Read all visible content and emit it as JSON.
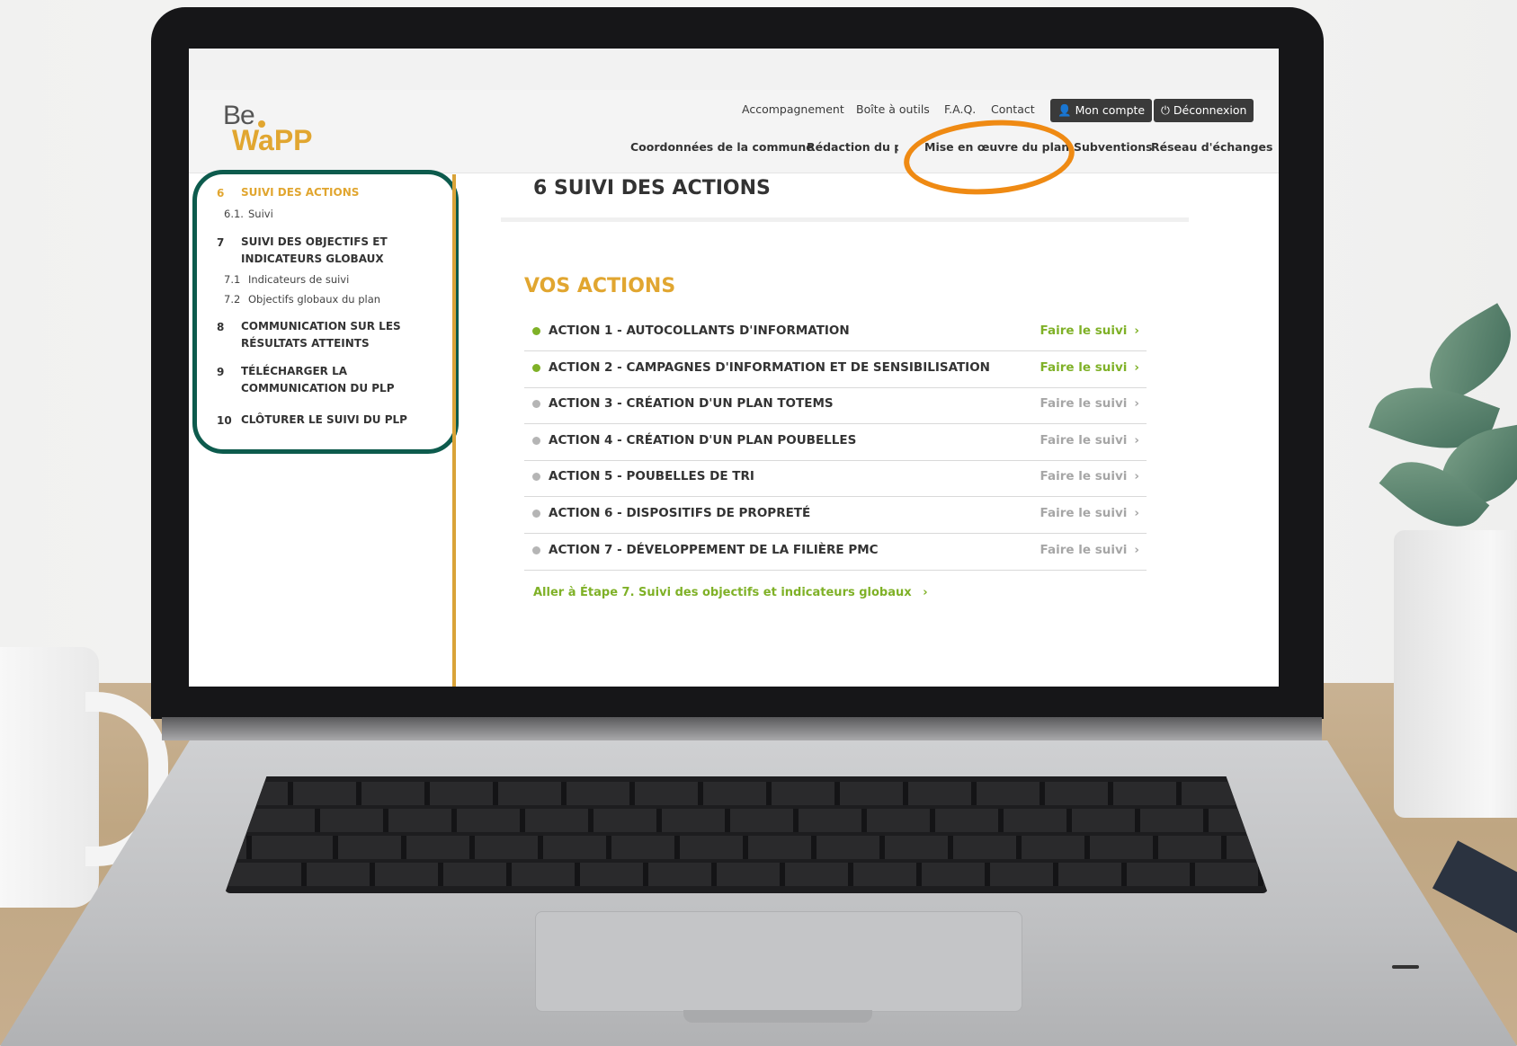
{
  "header": {
    "logo_line1": "Be",
    "logo_line2": "WaPP",
    "utility_links": [
      "Accompagnement",
      "Boîte à outils",
      "F.A.Q.",
      "Contact"
    ],
    "account_button": "Mon compte",
    "logout_button": "Déconnexion",
    "main_nav": [
      "Coordonnées de la commune",
      "Rédaction du plan",
      "Mise en œuvre du plan",
      "Subventions",
      "Réseau d'échanges"
    ],
    "highlighted_nav": "Mise en œuvre du plan"
  },
  "sidebar": {
    "items": [
      {
        "num": "6",
        "title": "SUIVI DES ACTIONS",
        "active": true,
        "subs": [
          {
            "num": "6.1.",
            "label": "Suivi"
          }
        ]
      },
      {
        "num": "7",
        "title_lines": [
          "SUIVI DES OBJECTIFS ET",
          "INDICATEURS GLOBAUX"
        ],
        "subs": [
          {
            "num": "7.1",
            "label": "Indicateurs de suivi"
          },
          {
            "num": "7.2",
            "label": "Objectifs globaux du plan"
          }
        ]
      },
      {
        "num": "8",
        "title_lines": [
          "COMMUNICATION SUR LES",
          "RÉSULTATS ATTEINTS"
        ]
      },
      {
        "num": "9",
        "title_lines": [
          "TÉLÉCHARGER LA",
          "COMMUNICATION DU PLP"
        ]
      },
      {
        "num": "10",
        "title": "CLÔTURER LE SUIVI DU PLP"
      }
    ]
  },
  "main": {
    "page_title": "6  SUIVI DES ACTIONS",
    "section_title": "VOS ACTIONS",
    "actions": [
      {
        "label": "ACTION 1 - AUTOCOLLANTS D'INFORMATION",
        "link": "Faire le suivi",
        "status": "active"
      },
      {
        "label": "ACTION 2 - CAMPAGNES D'INFORMATION ET DE SENSIBILISATION",
        "link": "Faire le suivi",
        "status": "active"
      },
      {
        "label": "ACTION 3 - CRÉATION D'UN PLAN TOTEMS",
        "link": "Faire le suivi",
        "status": "inactive"
      },
      {
        "label": "ACTION 4 - CRÉATION D'UN PLAN POUBELLES",
        "link": "Faire le suivi",
        "status": "inactive"
      },
      {
        "label": "ACTION 5 - POUBELLES DE TRI",
        "link": "Faire le suivi",
        "status": "inactive"
      },
      {
        "label": "ACTION 6 - DISPOSITIFS DE PROPRETÉ",
        "link": "Faire le suivi",
        "status": "inactive"
      },
      {
        "label": "ACTION 7 - DÉVELOPPEMENT DE LA FILIÈRE PMC",
        "link": "Faire le suivi",
        "status": "inactive"
      }
    ],
    "next_step_link": "Aller à Étape 7. Suivi des objectifs et indicateurs globaux"
  },
  "colors": {
    "gold": "#e1a630",
    "green": "#7fb127",
    "grey_link": "#a6a6a6",
    "sidebar_outline": "#0d5b4d",
    "highlight_circle": "#ef8a13"
  },
  "icons": {
    "account": "user-icon",
    "logout": "power-icon",
    "chevron": "chevron-right-icon"
  }
}
